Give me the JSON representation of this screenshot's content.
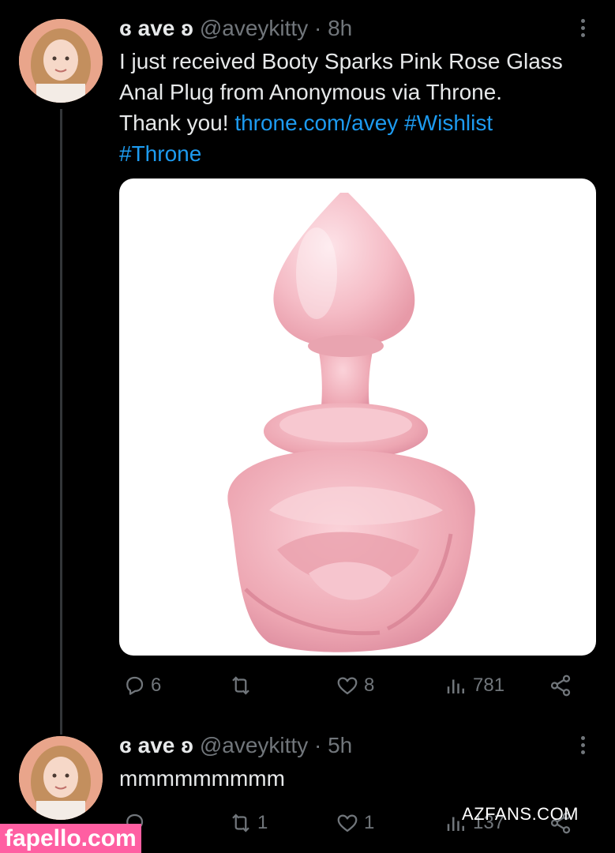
{
  "tweet1": {
    "name": "ɞ ave ʚ",
    "handle": "@aveykitty",
    "separator": "·",
    "time": "8h",
    "text_lines": [
      "I just received Booty Sparks Pink Rose Glass",
      "Anal Plug from Anonymous via Throne.",
      "Thank you! "
    ],
    "link1": "throne.com/avey",
    "link2": "#Wishlist",
    "link3": "#Throne",
    "actions": {
      "replies": "6",
      "reposts": "",
      "likes": "8",
      "views": "781"
    }
  },
  "tweet2": {
    "name": "ɞ ave ʚ",
    "handle": "@aveykitty",
    "separator": "·",
    "time": "5h",
    "text": "mmmmmmmmm",
    "actions": {
      "replies": "",
      "reposts": "1",
      "likes": "1",
      "views": "137"
    }
  },
  "watermarks": {
    "left": "fapello.com",
    "right": "AZFANS.COM"
  },
  "colors": {
    "background": "#000000",
    "text": "#e7e9ea",
    "muted": "#71767b",
    "link": "#1d9bf0",
    "media_bg": "#ffffff",
    "product": "#f4b9c3"
  },
  "icons": [
    "reply-icon",
    "repost-icon",
    "like-icon",
    "views-icon",
    "share-icon",
    "more-icon"
  ]
}
